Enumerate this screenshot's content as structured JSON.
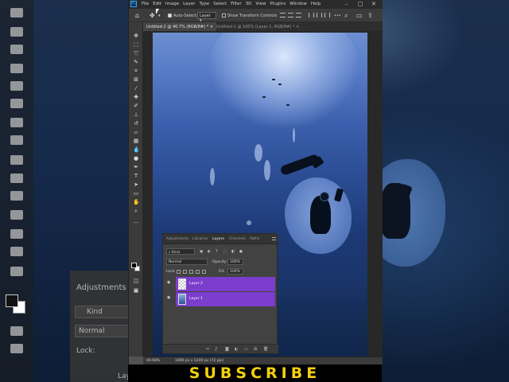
{
  "menu": [
    "File",
    "Edit",
    "Image",
    "Layer",
    "Type",
    "Select",
    "Filter",
    "3D",
    "View",
    "Plugins",
    "Window",
    "Help"
  ],
  "app_logo": "Ps",
  "window_controls": [
    "–",
    "□",
    "✕"
  ],
  "options_bar": {
    "auto_select_label": "Auto-Select:",
    "auto_select_value": "Layer",
    "show_transform_label": "Show Transform Controls",
    "more_label": "•••"
  },
  "tabs": [
    {
      "label": "Untitled-2 @ 40.7% (RGB/8#) *  ×",
      "active": true
    },
    {
      "label": "Untitled-1 @ 100% (Layer 1, RGB/8#) *  ×",
      "active": false
    }
  ],
  "layers_panel": {
    "tabs": [
      "Adjustments",
      "Libraries",
      "Layers",
      "Channels",
      "Paths"
    ],
    "active_tab": "Layers",
    "kind_label": "Kind",
    "blend_mode": "Normal",
    "opacity_label": "Opacity:",
    "opacity_value": "100%",
    "lock_label": "Lock:",
    "fill_label": "Fill:",
    "fill_value": "100%",
    "layers": [
      {
        "name": "Layer 2",
        "visible": true
      },
      {
        "name": "Layer 1",
        "visible": true
      }
    ],
    "accent_color": "#7a3dcc"
  },
  "status": {
    "zoom": "40.68%",
    "doc_info": "1080 px x 1249 px (72 ppi)"
  },
  "background_panel": {
    "title": "Adjustments",
    "kind_label": "Kind",
    "blend_mode": "Normal",
    "lock_label": "Lock:",
    "layer_label": "Lay"
  },
  "banner": {
    "text": "SUBSCRIBE",
    "color": "#f3d10c"
  }
}
